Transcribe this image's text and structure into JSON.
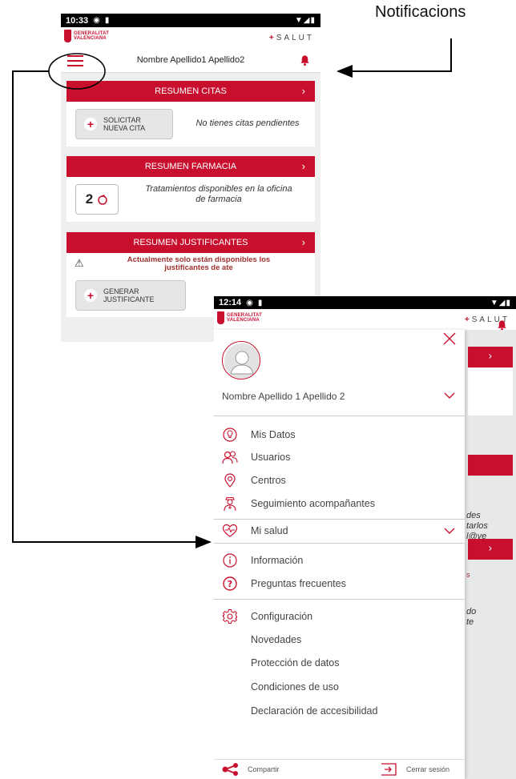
{
  "annotation": {
    "notifications_label": "Notificacions"
  },
  "brand": {
    "gv_line1": "GENERALITAT",
    "gv_line2": "VALENCIANA",
    "salut_plus": "+",
    "salut": "SALUT"
  },
  "screen1": {
    "status_time": "10:33",
    "user_name": "Nombre Apellido1 Apellido2",
    "citas": {
      "title": "RESUMEN CITAS",
      "button_line1": "SOLICITAR",
      "button_line2": "NUEVA CITA",
      "text": "No tienes citas pendientes"
    },
    "farmacia": {
      "title": "RESUMEN FARMACIA",
      "count": "2",
      "text_line1": "Tratamientos disponibles en la oficina",
      "text_line2": "de farmacia"
    },
    "justificantes": {
      "title": "RESUMEN JUSTIFICANTES",
      "warning_line1": "Actualmente solo están disponibles los",
      "warning_line2": "justificantes de ate",
      "button_line1": "GENERAR",
      "button_line2": "JUSTIFICANTE"
    }
  },
  "screen2": {
    "status_time": "12:14",
    "user_name": "Nombre Apellido 1 Apellido 2",
    "menu": [
      {
        "label": "Mis Datos",
        "icon": "lightbulb-icon"
      },
      {
        "label": "Usuarios",
        "icon": "users-icon"
      },
      {
        "label": "Centros",
        "icon": "location-pin-icon"
      },
      {
        "label": "Seguimiento acompañantes",
        "icon": "companion-icon"
      },
      {
        "label": "Mi salud",
        "icon": "heart-pulse-icon"
      },
      {
        "label": "Información",
        "icon": "info-icon"
      },
      {
        "label": "Preguntas frecuentes",
        "icon": "question-icon"
      },
      {
        "label": "Configuración",
        "icon": "gear-icon"
      },
      {
        "label": "Novedades"
      },
      {
        "label": "Protección de datos"
      },
      {
        "label": "Condiciones de uso"
      },
      {
        "label": "Declaración de accesibilidad"
      }
    ],
    "footer": {
      "share": "Compartir",
      "logout": "Cerrar sesión"
    },
    "behind": {
      "line1": "des",
      "line2": "tarlos",
      "line3": "l@ve",
      "line4": "s",
      "line5": "do",
      "line6": "te"
    }
  },
  "colors": {
    "brand_red": "#c8102e",
    "status_bar": "#000000",
    "background_grey": "#efefef"
  }
}
